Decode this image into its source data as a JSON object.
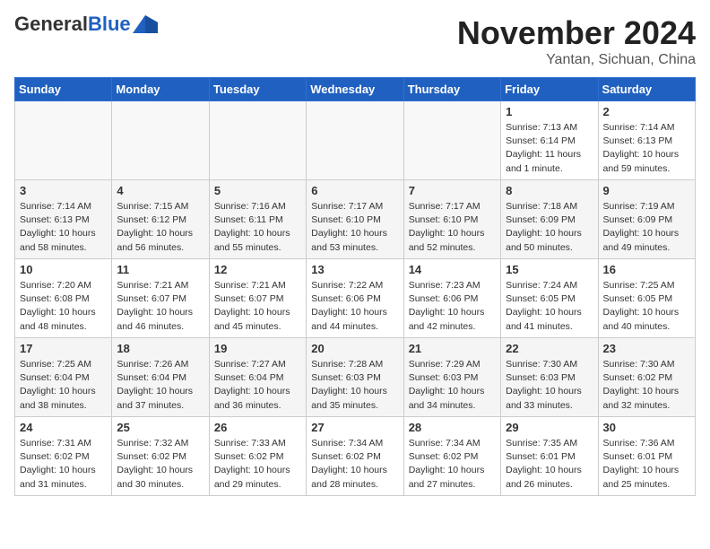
{
  "header": {
    "logo_general": "General",
    "logo_blue": "Blue",
    "month_title": "November 2024",
    "location": "Yantan, Sichuan, China"
  },
  "days_of_week": [
    "Sunday",
    "Monday",
    "Tuesday",
    "Wednesday",
    "Thursday",
    "Friday",
    "Saturday"
  ],
  "weeks": [
    [
      {
        "day": "",
        "info": ""
      },
      {
        "day": "",
        "info": ""
      },
      {
        "day": "",
        "info": ""
      },
      {
        "day": "",
        "info": ""
      },
      {
        "day": "",
        "info": ""
      },
      {
        "day": "1",
        "info": "Sunrise: 7:13 AM\nSunset: 6:14 PM\nDaylight: 11 hours\nand 1 minute."
      },
      {
        "day": "2",
        "info": "Sunrise: 7:14 AM\nSunset: 6:13 PM\nDaylight: 10 hours\nand 59 minutes."
      }
    ],
    [
      {
        "day": "3",
        "info": "Sunrise: 7:14 AM\nSunset: 6:13 PM\nDaylight: 10 hours\nand 58 minutes."
      },
      {
        "day": "4",
        "info": "Sunrise: 7:15 AM\nSunset: 6:12 PM\nDaylight: 10 hours\nand 56 minutes."
      },
      {
        "day": "5",
        "info": "Sunrise: 7:16 AM\nSunset: 6:11 PM\nDaylight: 10 hours\nand 55 minutes."
      },
      {
        "day": "6",
        "info": "Sunrise: 7:17 AM\nSunset: 6:10 PM\nDaylight: 10 hours\nand 53 minutes."
      },
      {
        "day": "7",
        "info": "Sunrise: 7:17 AM\nSunset: 6:10 PM\nDaylight: 10 hours\nand 52 minutes."
      },
      {
        "day": "8",
        "info": "Sunrise: 7:18 AM\nSunset: 6:09 PM\nDaylight: 10 hours\nand 50 minutes."
      },
      {
        "day": "9",
        "info": "Sunrise: 7:19 AM\nSunset: 6:09 PM\nDaylight: 10 hours\nand 49 minutes."
      }
    ],
    [
      {
        "day": "10",
        "info": "Sunrise: 7:20 AM\nSunset: 6:08 PM\nDaylight: 10 hours\nand 48 minutes."
      },
      {
        "day": "11",
        "info": "Sunrise: 7:21 AM\nSunset: 6:07 PM\nDaylight: 10 hours\nand 46 minutes."
      },
      {
        "day": "12",
        "info": "Sunrise: 7:21 AM\nSunset: 6:07 PM\nDaylight: 10 hours\nand 45 minutes."
      },
      {
        "day": "13",
        "info": "Sunrise: 7:22 AM\nSunset: 6:06 PM\nDaylight: 10 hours\nand 44 minutes."
      },
      {
        "day": "14",
        "info": "Sunrise: 7:23 AM\nSunset: 6:06 PM\nDaylight: 10 hours\nand 42 minutes."
      },
      {
        "day": "15",
        "info": "Sunrise: 7:24 AM\nSunset: 6:05 PM\nDaylight: 10 hours\nand 41 minutes."
      },
      {
        "day": "16",
        "info": "Sunrise: 7:25 AM\nSunset: 6:05 PM\nDaylight: 10 hours\nand 40 minutes."
      }
    ],
    [
      {
        "day": "17",
        "info": "Sunrise: 7:25 AM\nSunset: 6:04 PM\nDaylight: 10 hours\nand 38 minutes."
      },
      {
        "day": "18",
        "info": "Sunrise: 7:26 AM\nSunset: 6:04 PM\nDaylight: 10 hours\nand 37 minutes."
      },
      {
        "day": "19",
        "info": "Sunrise: 7:27 AM\nSunset: 6:04 PM\nDaylight: 10 hours\nand 36 minutes."
      },
      {
        "day": "20",
        "info": "Sunrise: 7:28 AM\nSunset: 6:03 PM\nDaylight: 10 hours\nand 35 minutes."
      },
      {
        "day": "21",
        "info": "Sunrise: 7:29 AM\nSunset: 6:03 PM\nDaylight: 10 hours\nand 34 minutes."
      },
      {
        "day": "22",
        "info": "Sunrise: 7:30 AM\nSunset: 6:03 PM\nDaylight: 10 hours\nand 33 minutes."
      },
      {
        "day": "23",
        "info": "Sunrise: 7:30 AM\nSunset: 6:02 PM\nDaylight: 10 hours\nand 32 minutes."
      }
    ],
    [
      {
        "day": "24",
        "info": "Sunrise: 7:31 AM\nSunset: 6:02 PM\nDaylight: 10 hours\nand 31 minutes."
      },
      {
        "day": "25",
        "info": "Sunrise: 7:32 AM\nSunset: 6:02 PM\nDaylight: 10 hours\nand 30 minutes."
      },
      {
        "day": "26",
        "info": "Sunrise: 7:33 AM\nSunset: 6:02 PM\nDaylight: 10 hours\nand 29 minutes."
      },
      {
        "day": "27",
        "info": "Sunrise: 7:34 AM\nSunset: 6:02 PM\nDaylight: 10 hours\nand 28 minutes."
      },
      {
        "day": "28",
        "info": "Sunrise: 7:34 AM\nSunset: 6:02 PM\nDaylight: 10 hours\nand 27 minutes."
      },
      {
        "day": "29",
        "info": "Sunrise: 7:35 AM\nSunset: 6:01 PM\nDaylight: 10 hours\nand 26 minutes."
      },
      {
        "day": "30",
        "info": "Sunrise: 7:36 AM\nSunset: 6:01 PM\nDaylight: 10 hours\nand 25 minutes."
      }
    ]
  ]
}
